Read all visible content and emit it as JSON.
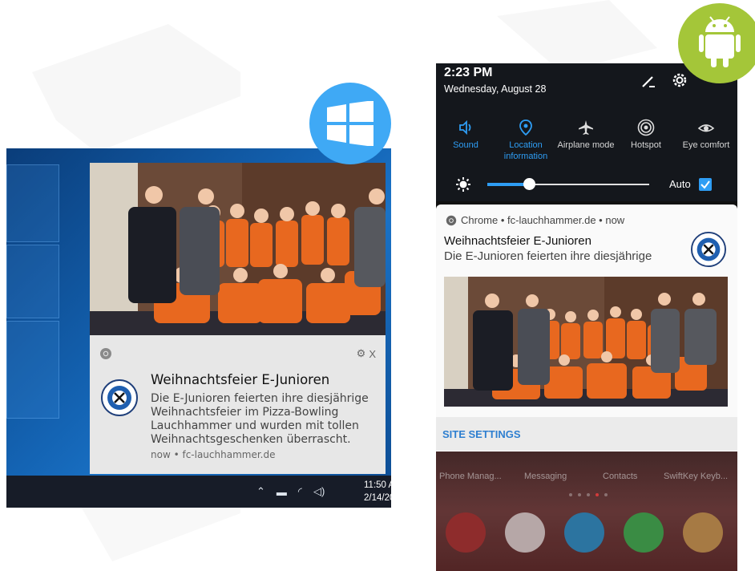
{
  "windows": {
    "toast": {
      "title": "Weihnachtsfeier E-Junioren",
      "body": "Die  E-Junioren feierten ihre diesjährige Weihnachtsfeier im Pizza-Bowling Lauchhammer und wurden mit tollen Weihnachtsgeschenken überrascht.",
      "meta": "now • fc-lauchhammer.de",
      "close_label": "X"
    },
    "taskbar": {
      "time": "11:50 A",
      "date": "2/14/20"
    }
  },
  "android": {
    "status": {
      "time": "2:23 PM",
      "date": "Wednesday, August 28"
    },
    "tiles": [
      {
        "label": "Sound",
        "icon": "sound-icon",
        "active": true
      },
      {
        "label": "Location information",
        "icon": "location-icon",
        "active": true
      },
      {
        "label": "Airplane mode",
        "icon": "airplane-icon",
        "active": false
      },
      {
        "label": "Hotspot",
        "icon": "hotspot-icon",
        "active": false
      },
      {
        "label": "Eye comfort",
        "icon": "eye-icon",
        "active": false
      }
    ],
    "brightness": {
      "auto_label": "Auto",
      "level": 0.23
    },
    "notification": {
      "header": "Chrome • fc-lauchhammer.de • now",
      "title": "Weihnachtsfeier E-Junioren",
      "body": "Die  E-Junioren feierten ihre diesjährige"
    },
    "site_settings": "SITE SETTINGS",
    "home_apps": [
      "Phone Manag...",
      "Messaging",
      "Contacts",
      "SwiftKey Keyb..."
    ],
    "dock": [
      "phone-icon",
      "gmail-icon",
      "skype-icon",
      "whatsapp-icon",
      "chrome-icon"
    ]
  },
  "colors": {
    "windows_accent": "#3fa9f5",
    "android_accent": "#a4c639",
    "android_blue": "#2e9df4"
  }
}
